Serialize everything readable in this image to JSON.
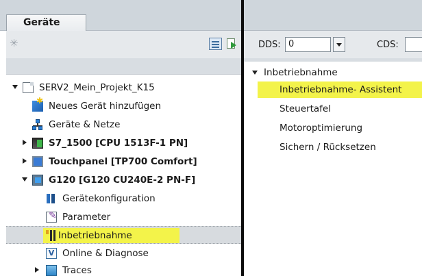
{
  "left_pane": {
    "tab": "Geräte",
    "tree": [
      {
        "label": "SERV2_Mein_Projekt_K15",
        "bold": false
      },
      {
        "label": "Neues Gerät hinzufügen",
        "bold": false
      },
      {
        "label": "Geräte & Netze",
        "bold": false
      },
      {
        "label": "S7_1500 [CPU 1513F-1 PN]",
        "bold": true
      },
      {
        "label": "Touchpanel [TP700 Comfort]",
        "bold": true
      },
      {
        "label": "G120 [G120 CU240E-2 PN-F]",
        "bold": true
      },
      {
        "label": "Gerätekonfiguration",
        "bold": false
      },
      {
        "label": "Parameter",
        "bold": false
      },
      {
        "label": "Inbetriebnahme",
        "bold": false,
        "selected": true
      },
      {
        "label": "Online & Diagnose",
        "bold": false
      },
      {
        "label": "Traces",
        "bold": false
      }
    ]
  },
  "right_pane": {
    "toolbar": {
      "dds_label": "DDS:",
      "dds_value": "0",
      "cds_label": "CDS:"
    },
    "group": {
      "label": "Inbetriebnahme",
      "items": [
        {
          "label": "Inbetriebnahme- Assistent",
          "highlighted": true
        },
        {
          "label": "Steuertafel"
        },
        {
          "label": "Motoroptimierung"
        },
        {
          "label": "Sichern / Rücksetzen"
        }
      ]
    }
  },
  "colors": {
    "highlight": "#f3f34a",
    "panel_header": "#cfd6dc",
    "toolbar": "#e6e9ec",
    "splitter": "#0c0c0c"
  },
  "icons": {
    "project": "project-icon",
    "new_device": "add-device-icon",
    "devices_networks": "network-icon",
    "plc": "plc-icon",
    "hmi": "hmi-panel-icon",
    "drive": "drive-icon",
    "device_config": "device-config-icon",
    "parameter": "parameter-icon",
    "commissioning": "commissioning-icon",
    "online_diag": "online-diagnostics-icon",
    "traces": "traces-folder-icon"
  }
}
